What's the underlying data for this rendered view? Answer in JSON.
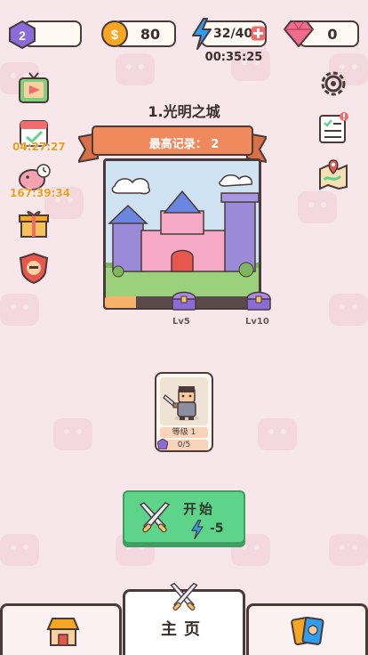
{
  "topbar": {
    "level": "2",
    "coins": "80",
    "energy": "32/40",
    "gems": "0",
    "energy_timer": "00:35:25"
  },
  "side": {
    "event1_timer": "04:27:27",
    "event2_timer": "167:39:34"
  },
  "stage": {
    "title": "1.光明之城",
    "best_record": "最高记录： 2",
    "progress": 0.2,
    "chest1_label": "Lv5",
    "chest2_label": "Lv10"
  },
  "hero": {
    "level_label": "等级 1",
    "fragments": "0/5"
  },
  "start": {
    "label": "开始",
    "cost": "-5"
  },
  "nav": {
    "home_label": "主页"
  },
  "colors": {
    "accent_green": "#5ed38a",
    "banner_orange": "#f08a5d",
    "gem_pink": "#f06c8e",
    "energy_blue": "#2f9df0",
    "coin_orange": "#f5a623",
    "level_purple": "#8a6bd8",
    "timer_orange": "#f39a1a"
  }
}
